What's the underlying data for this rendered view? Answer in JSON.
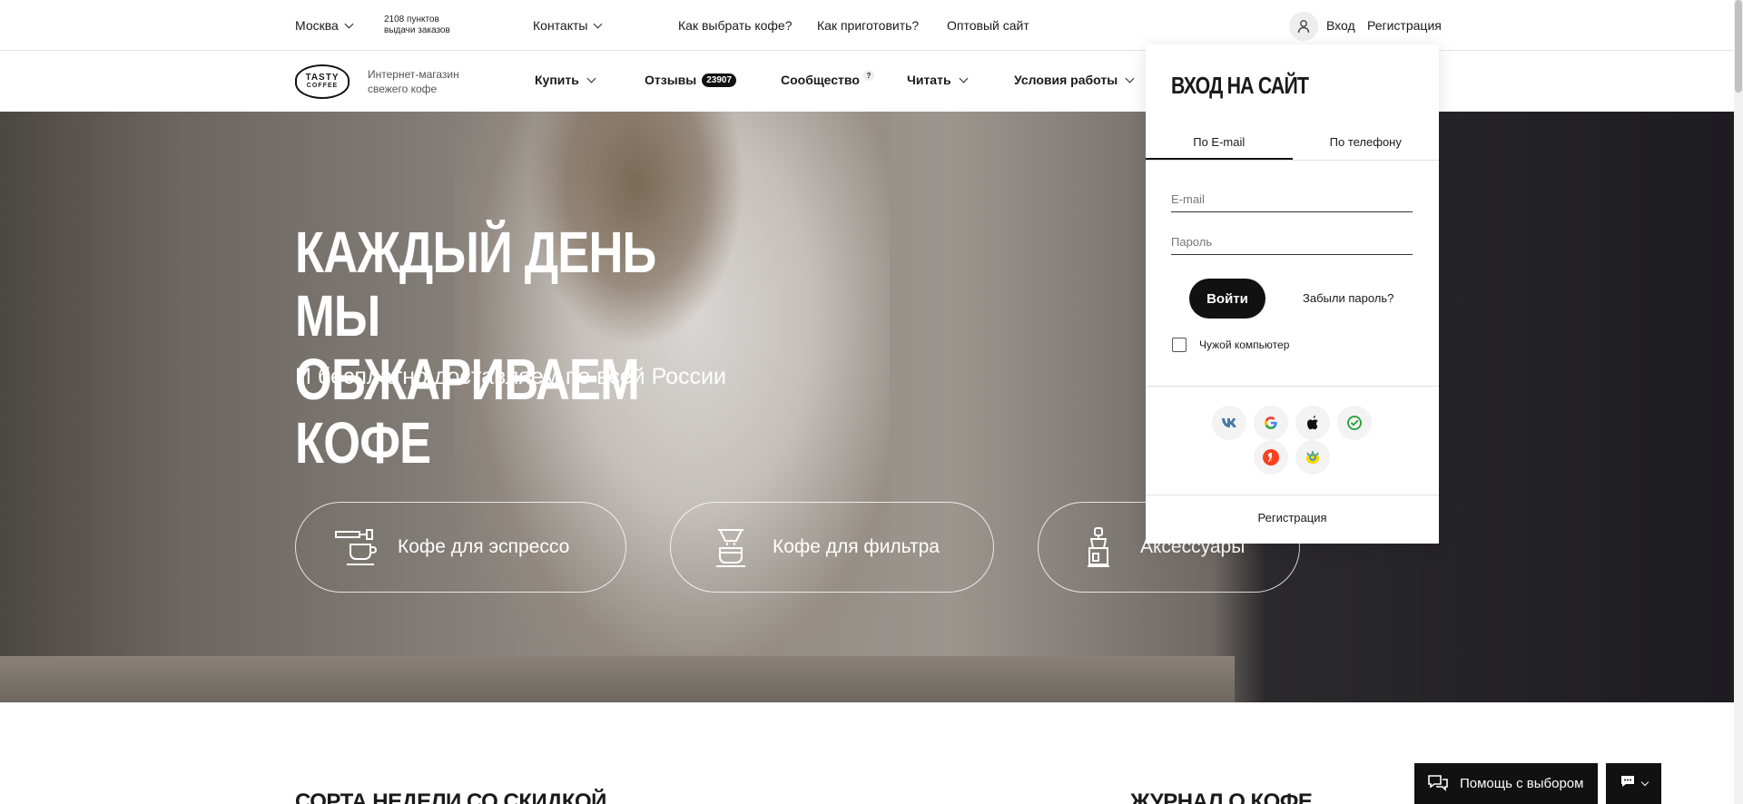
{
  "topbar": {
    "city": "Москва",
    "pickup_line1": "2108 пунктов",
    "pickup_line2": "выдачи заказов",
    "contacts": "Контакты",
    "links": [
      "Как выбрать кофе?",
      "Как приготовить?",
      "Оптовый сайт"
    ],
    "login": "Вход",
    "register": "Регистрация"
  },
  "nav": {
    "logo_line1": "TASTY",
    "logo_line2": "COFFEE",
    "tagline": "Интернет-магазин свежего кофе",
    "buy": "Купить",
    "reviews": "Отзывы",
    "reviews_count": "23907",
    "community": "Сообщество",
    "community_badge": "?",
    "read": "Читать",
    "terms": "Условия работы"
  },
  "hero": {
    "title_line1": "КАЖДЫЙ ДЕНЬ МЫ",
    "title_line2": "ОБЖАРИВАЕМ КОФЕ",
    "subtitle": "И бесплатно доставляем по всей России",
    "categories": [
      {
        "label": "Кофе для эспрессо",
        "icon": "espresso-machine-icon"
      },
      {
        "label": "Кофе для фильтра",
        "icon": "filter-dripper-icon"
      },
      {
        "label": "Аксессуары",
        "icon": "grinder-icon"
      }
    ]
  },
  "login_popup": {
    "title": "ВХОД НА САЙТ",
    "tab_email": "По E-mail",
    "tab_phone": "По телефону",
    "email_placeholder": "E-mail",
    "password_placeholder": "Пароль",
    "submit": "Войти",
    "forgot": "Забыли пароль?",
    "foreign_computer": "Чужой компьютер",
    "social": [
      "vk-icon",
      "google-icon",
      "apple-icon",
      "sber-id-icon",
      "yandex-icon",
      "mailru-icon"
    ],
    "register": "Регистрация"
  },
  "bottom": {
    "left_heading": "СОРТА НЕДЕЛИ СО СКИДКОЙ",
    "right_heading": "ЖУРНАЛ О КОФЕ",
    "help_button": "Помощь с выбором"
  }
}
